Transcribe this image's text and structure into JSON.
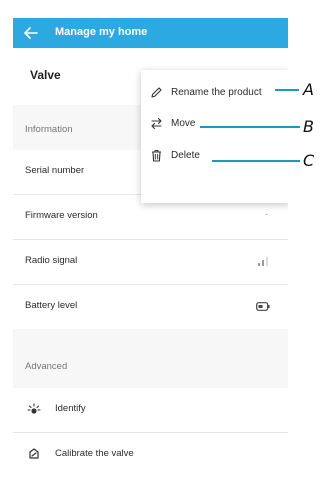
{
  "topbar": {
    "title": "Manage my home"
  },
  "product": {
    "name": "Valve"
  },
  "sections": {
    "information": "Information",
    "advanced": "Advanced"
  },
  "info_rows": [
    {
      "label": "Serial number",
      "value": ""
    },
    {
      "label": "Firmware version",
      "value": "-"
    },
    {
      "label": "Radio signal",
      "value": ""
    },
    {
      "label": "Battery level",
      "value": ""
    }
  ],
  "advanced_rows": [
    {
      "label": "Identify",
      "icon": "identify-icon"
    },
    {
      "label": "Calibrate the valve",
      "icon": "calibrate-icon"
    }
  ],
  "menu": {
    "items": [
      {
        "label": "Rename the product",
        "icon": "pencil-icon"
      },
      {
        "label": "Move",
        "icon": "move-arrows-icon"
      },
      {
        "label": "Delete",
        "icon": "trash-icon"
      }
    ]
  },
  "callouts": {
    "a": "A",
    "b": "B",
    "c": "C"
  },
  "colors": {
    "accent": "#2da9e1",
    "callout_line": "#1a9bbd"
  }
}
